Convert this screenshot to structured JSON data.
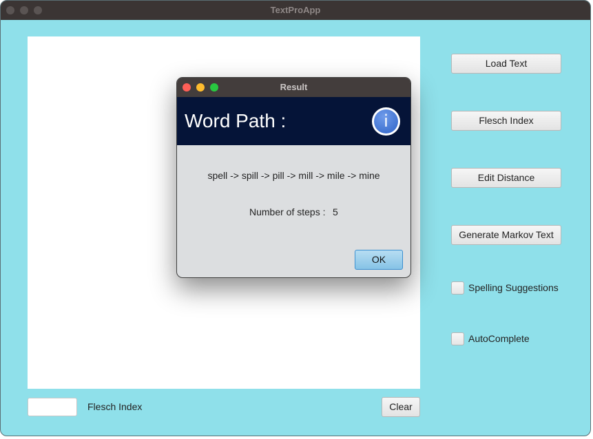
{
  "window": {
    "title": "TextProApp"
  },
  "side_buttons": {
    "load_text": "Load Text",
    "flesch_index": "Flesch Index",
    "edit_distance": "Edit Distance",
    "generate_markov": "Generate Markov Text"
  },
  "checkboxes": {
    "spelling": {
      "label": "Spelling Suggestions",
      "checked": false
    },
    "autocomplete": {
      "label": "AutoComplete",
      "checked": false
    }
  },
  "bottom": {
    "flesch_value": "",
    "flesch_label": "Flesch Index",
    "clear_label": "Clear"
  },
  "dialog": {
    "title": "Result",
    "heading": "Word Path :",
    "info_icon_glyph": "i",
    "path": "spell -> spill -> pill -> mill -> mile -> mine",
    "steps_label": "Number of steps :",
    "steps_value": "5",
    "ok_label": "OK"
  },
  "colors": {
    "window_bg": "#8fe0ea",
    "dialog_header_bg": "#051438",
    "close": "#fe5f57",
    "minimize": "#febc2e",
    "zoom": "#28c840"
  }
}
